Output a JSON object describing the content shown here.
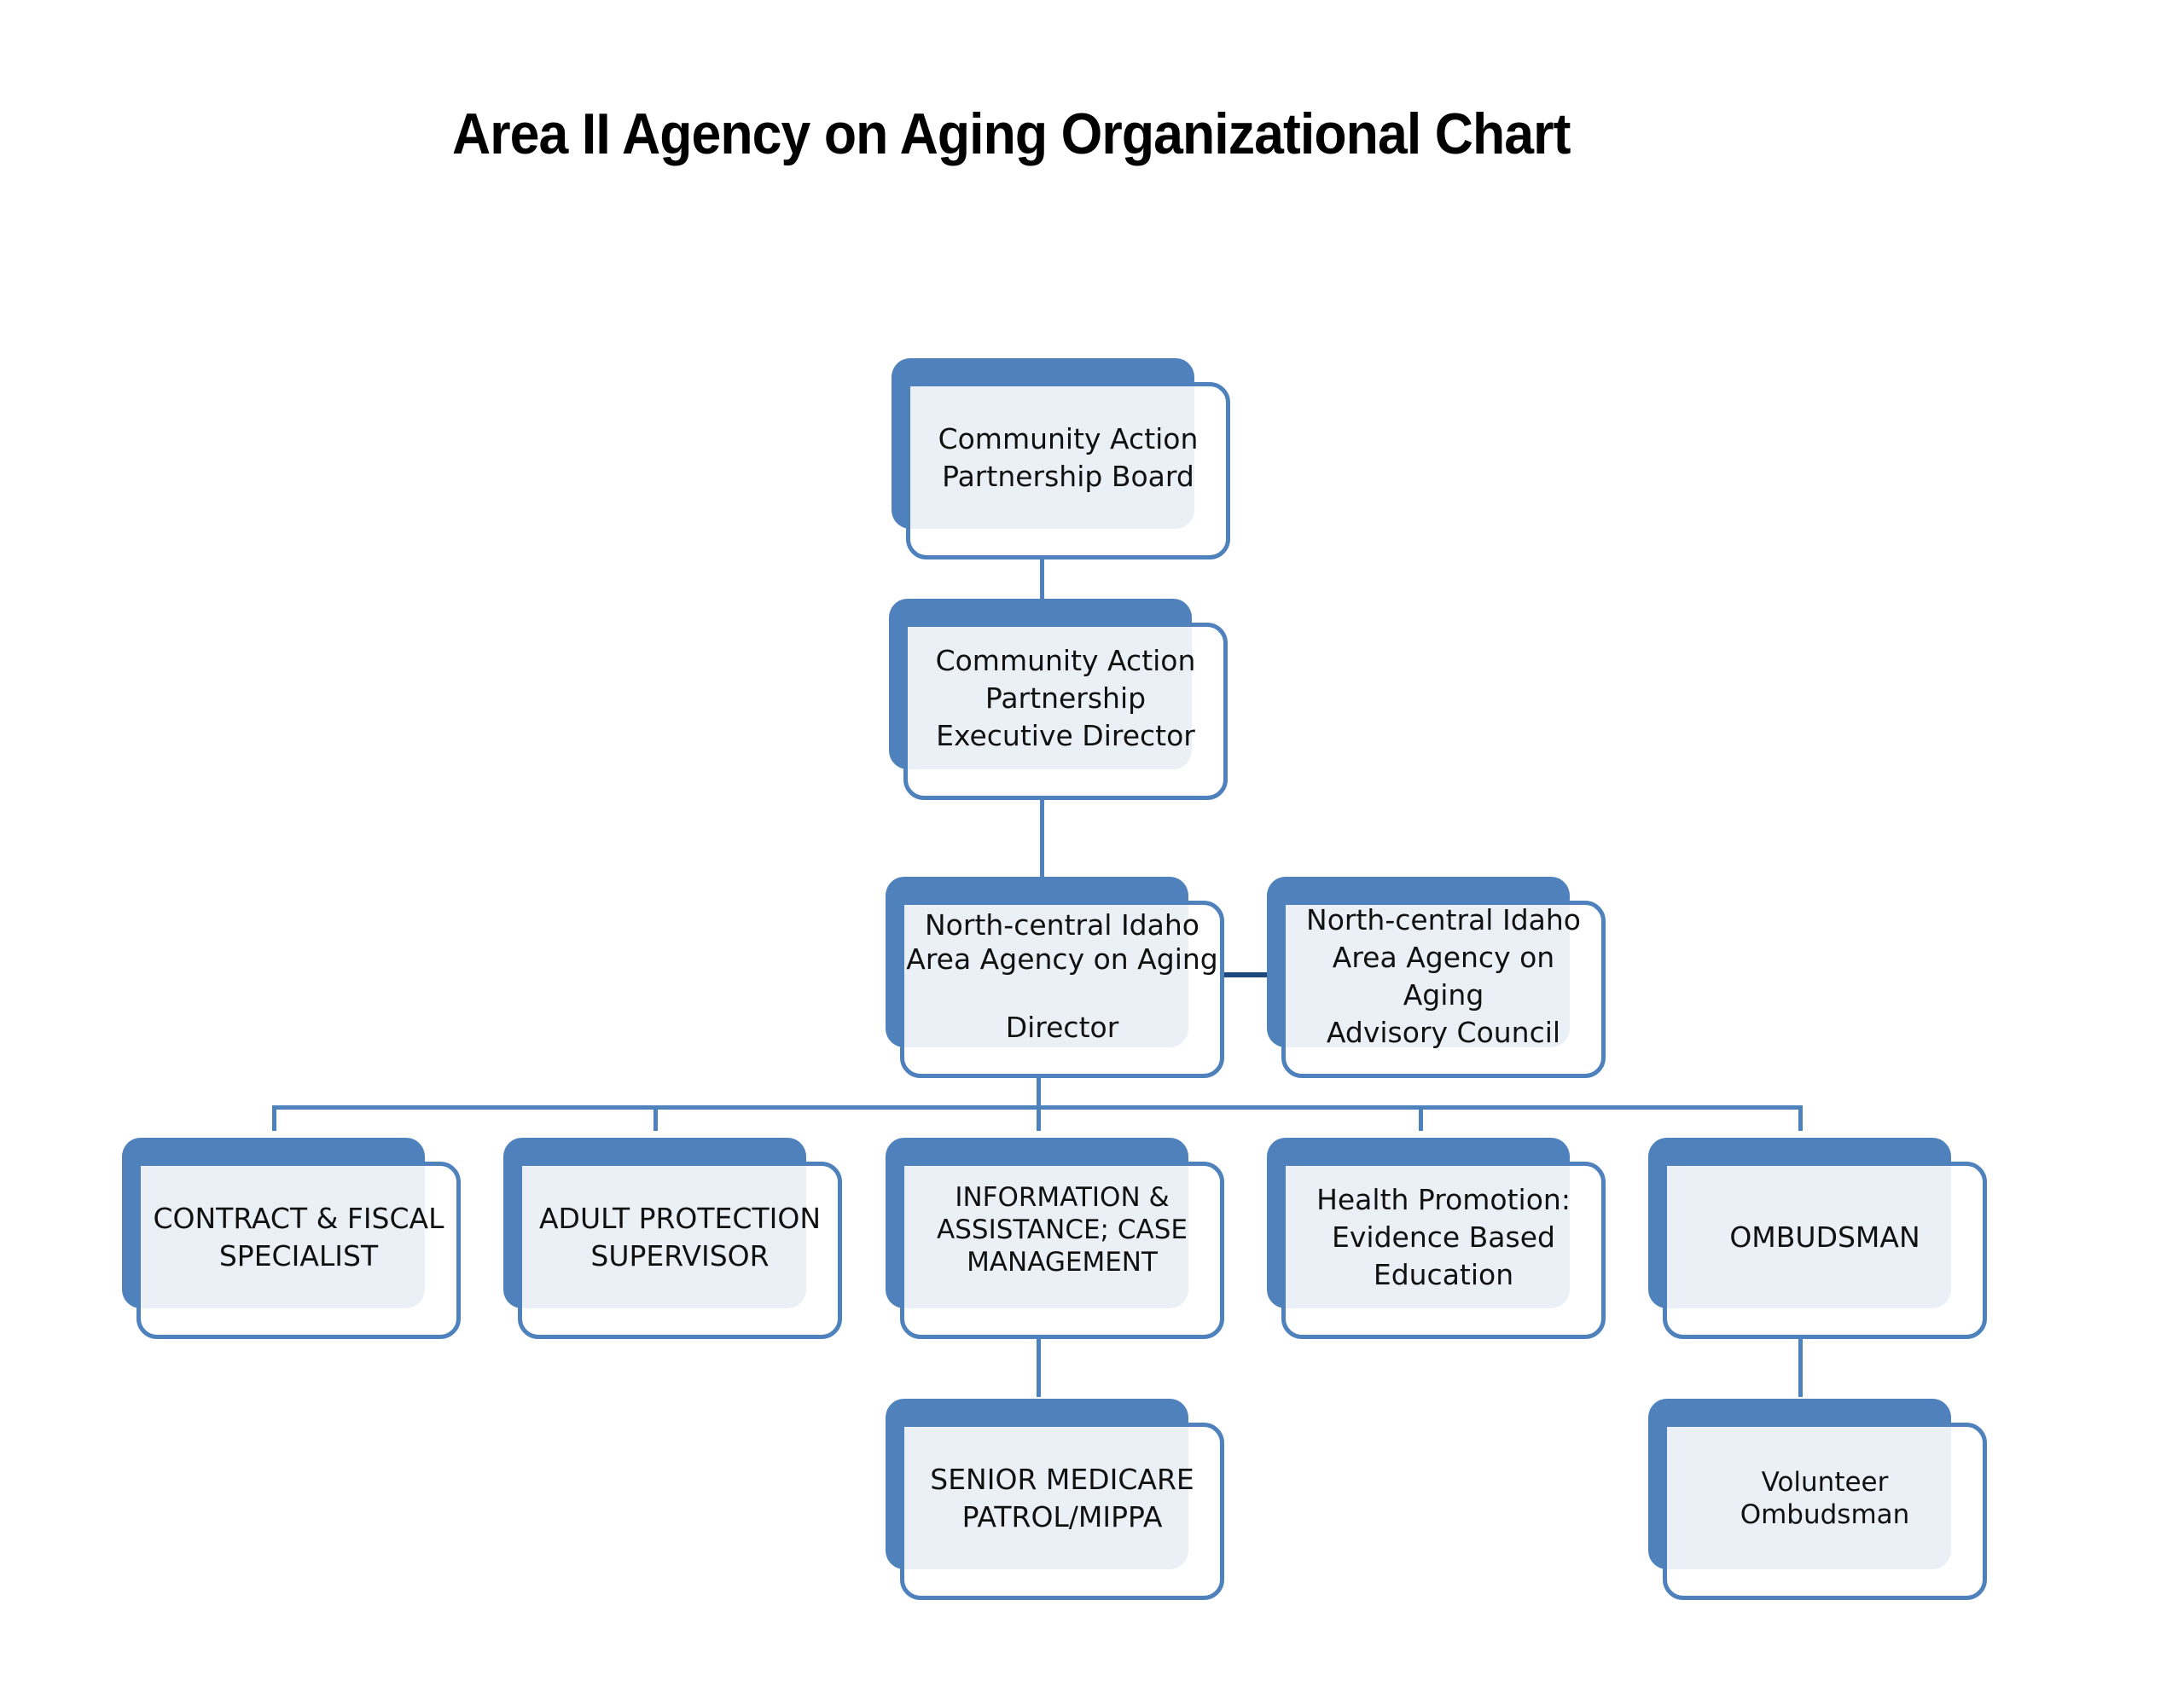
{
  "title": "Area II Agency on Aging Organizational Chart",
  "colors": {
    "accent": "#4f81bd",
    "fill": "#ebf0f7",
    "connector_dark": "#1f497d"
  },
  "nodes": {
    "board": {
      "label": "Community Action\nPartnership Board"
    },
    "exec_director": {
      "label": "Community Action\nPartnership\nExecutive Director"
    },
    "aaa_director": {
      "label": "North-central Idaho\nArea Agency on Aging\n\nDirector"
    },
    "advisory_council": {
      "label": "North-central Idaho\nArea Agency on\nAging\nAdvisory Council"
    },
    "contract_fiscal": {
      "label": "CONTRACT & FISCAL\nSPECIALIST"
    },
    "adult_protection": {
      "label": "ADULT PROTECTION\nSUPERVISOR"
    },
    "info_assistance": {
      "label": "INFORMATION &\nASSISTANCE;  CASE\nMANAGEMENT"
    },
    "health_promotion": {
      "label": "Health Promotion:\nEvidence Based\nEducation"
    },
    "ombudsman": {
      "label": "OMBUDSMAN"
    },
    "senior_medicare": {
      "label": "SENIOR MEDICARE\nPATROL/MIPPA"
    },
    "volunteer_ombudsman": {
      "label": "Volunteer\nOmbudsman"
    }
  }
}
